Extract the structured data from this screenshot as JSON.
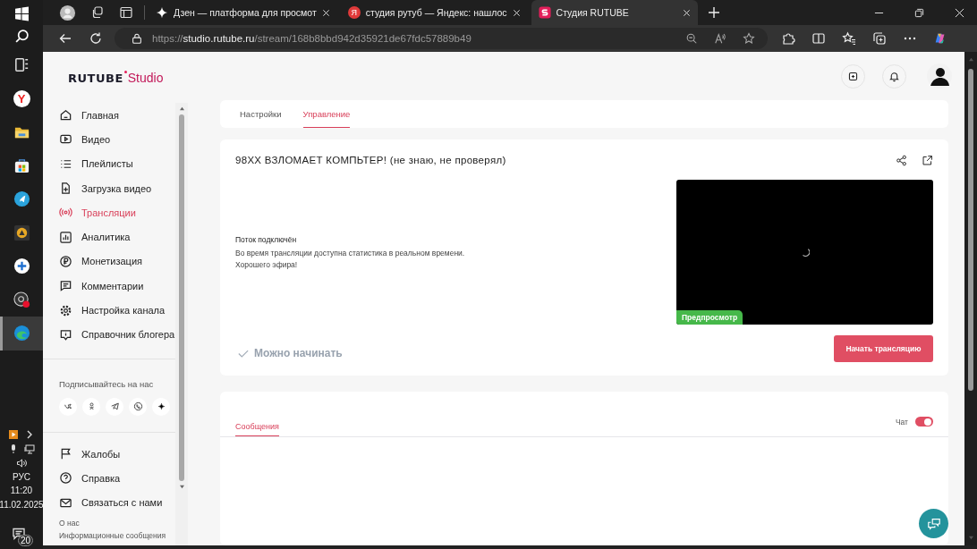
{
  "taskbar": {
    "apps": [
      {
        "kind": "widgets",
        "selected": false
      },
      {
        "kind": "yandex",
        "glyph": "Y",
        "selected": false
      },
      {
        "kind": "folder",
        "selected": false
      },
      {
        "kind": "store",
        "selected": false
      },
      {
        "kind": "telegram",
        "selected": false
      },
      {
        "kind": "warning",
        "selected": false
      },
      {
        "kind": "plus",
        "selected": false
      },
      {
        "kind": "obs",
        "selected": false
      },
      {
        "kind": "edge",
        "selected": true
      }
    ],
    "language": "РУС",
    "time": "11:20",
    "date": "11.02.2025",
    "notifications": "20"
  },
  "browser": {
    "tabs": [
      {
        "kind": "sparkle",
        "title": "Дзен — платформа для просмот",
        "selected": false
      },
      {
        "kind": "letter",
        "favicon": "Я",
        "title": "студия рутуб — Яндекс: нашлос",
        "selected": false
      },
      {
        "kind": "studio",
        "title": "Студия RUTUBE",
        "selected": true
      }
    ],
    "url": {
      "scheme": "https://",
      "host": "studio.rutube.ru",
      "path": "/stream/168b8bbd942d35921de67fdc57889b49"
    }
  },
  "logo": {
    "brand": "RUTUBE",
    "product": "Studio"
  },
  "nav": {
    "items": [
      {
        "kind": "home",
        "label": "Главная",
        "selected": false
      },
      {
        "kind": "video",
        "label": "Видео",
        "selected": false
      },
      {
        "kind": "list",
        "label": "Плейлисты",
        "selected": false
      },
      {
        "kind": "upload",
        "label": "Загрузка видео",
        "selected": false
      },
      {
        "kind": "broadcast",
        "label": "Трансляции",
        "selected": true
      },
      {
        "kind": "chart",
        "label": "Аналитика",
        "selected": false
      },
      {
        "kind": "ruble",
        "label": "Монетизация",
        "selected": false
      },
      {
        "kind": "comment",
        "label": "Комментарии",
        "selected": false
      },
      {
        "kind": "gear",
        "label": "Настройка канала",
        "selected": false
      },
      {
        "kind": "info",
        "label": "Справочник блогера",
        "selected": false
      }
    ],
    "social_heading": "Подписывайтесь на нас",
    "social": [
      {
        "kind": "vk"
      },
      {
        "kind": "ok"
      },
      {
        "kind": "plane"
      },
      {
        "kind": "phone"
      },
      {
        "kind": "sparkle"
      }
    ],
    "bottom_items": [
      {
        "kind": "flag",
        "label": "Жалобы"
      },
      {
        "kind": "question",
        "label": "Справка"
      },
      {
        "kind": "mail",
        "label": "Связаться с нами"
      }
    ],
    "footer_links": [
      "О нас",
      "Информационные сообщения"
    ]
  },
  "tabs": [
    {
      "label": "Настройки",
      "selected": false
    },
    {
      "label": "Управление",
      "selected": true
    }
  ],
  "stream": {
    "title": "98XX ВЗЛОМАЕТ КОМПЬТЕР! (не знаю, не проверял)",
    "status_heading": "Поток подключён",
    "status_lines": [
      "Во время трансляции доступна статистика в реальном времени.",
      "Хорошего эфира!"
    ],
    "ready_label": "Можно начинать",
    "preview_badge": "Предпросмотр",
    "start_button": "Начать трансляцию"
  },
  "chat": {
    "tabs": [
      {
        "label": "Сообщения",
        "selected": true
      }
    ],
    "toggle_label": "Чат",
    "toggle_on": true
  }
}
